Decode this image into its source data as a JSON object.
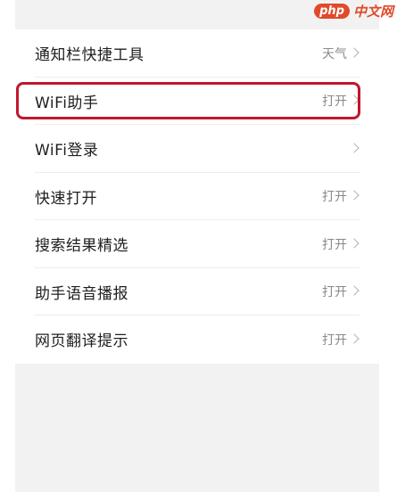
{
  "watermark": {
    "badge": "php",
    "text": "中文网"
  },
  "settings": {
    "items": [
      {
        "label": "通知栏快捷工具",
        "value": "天气"
      },
      {
        "label": "WiFi助手",
        "value": "打开"
      },
      {
        "label": "WiFi登录",
        "value": ""
      },
      {
        "label": "快速打开",
        "value": "打开"
      },
      {
        "label": "搜索结果精选",
        "value": "打开"
      },
      {
        "label": "助手语音播报",
        "value": "打开"
      },
      {
        "label": "网页翻译提示",
        "value": "打开"
      }
    ]
  },
  "highlight": {
    "target": "WiFi助手",
    "color": "#c0172e"
  }
}
